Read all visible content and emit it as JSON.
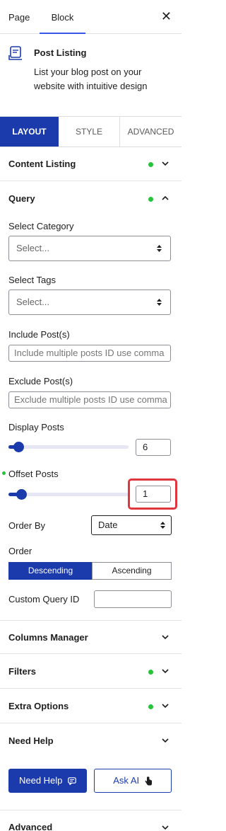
{
  "header": {
    "tabs": [
      {
        "label": "Page"
      },
      {
        "label": "Block"
      }
    ],
    "close_icon": "close-icon"
  },
  "block": {
    "title": "Post Listing",
    "description": "List your blog post on your website with intuitive design",
    "icon": "post-listing-icon"
  },
  "mode_tabs": [
    {
      "label": "LAYOUT",
      "active": true
    },
    {
      "label": "STYLE"
    },
    {
      "label": "ADVANCED"
    }
  ],
  "sections": {
    "content_listing": "Content Listing",
    "query": "Query",
    "columns_manager": "Columns Manager",
    "filters": "Filters",
    "extra_options": "Extra Options",
    "need_help": "Need Help",
    "advanced": "Advanced"
  },
  "query": {
    "select_category": {
      "label": "Select Category",
      "value": "Select..."
    },
    "select_tags": {
      "label": "Select Tags",
      "value": "Select..."
    },
    "include_posts": {
      "label": "Include Post(s)",
      "placeholder": "Include multiple posts ID use comma"
    },
    "exclude_posts": {
      "label": "Exclude Post(s)",
      "placeholder": "Exclude multiple posts ID use comma"
    },
    "display_posts": {
      "label": "Display Posts",
      "value": "6",
      "slider_fraction": 0.09
    },
    "offset_posts": {
      "label": "Offset Posts",
      "value": "1",
      "slider_fraction": 0.11
    },
    "order_by": {
      "label": "Order By",
      "value": "Date"
    },
    "order": {
      "label": "Order",
      "options": [
        "Descending",
        "Ascending"
      ],
      "selected": "Descending"
    },
    "custom_query_id": {
      "label": "Custom Query ID",
      "value": ""
    }
  },
  "help_buttons": {
    "need_help": "Need Help",
    "ask_ai": "Ask AI"
  },
  "colors": {
    "accent": "#1b3bac",
    "status_dot": "#26c33b",
    "highlight": "#e0363e"
  }
}
